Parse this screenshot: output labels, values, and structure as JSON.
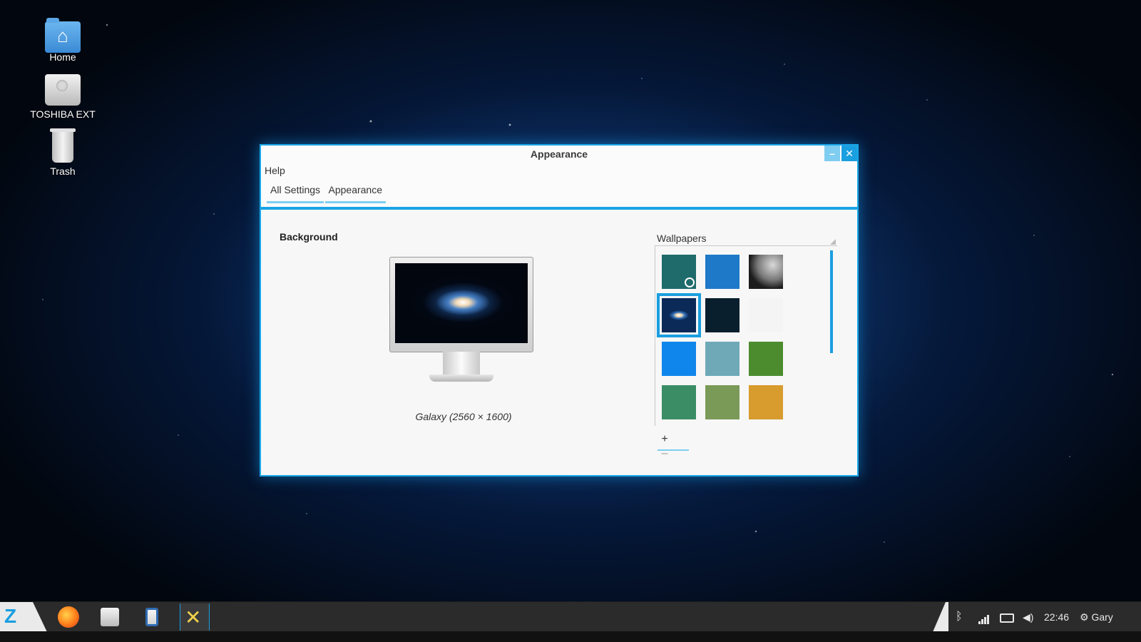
{
  "desktop": {
    "icons": [
      {
        "label": "Home",
        "icon": "folder-home-icon"
      },
      {
        "label": "TOSHIBA EXT",
        "icon": "drive-icon"
      },
      {
        "label": "Trash",
        "icon": "trash-icon"
      }
    ]
  },
  "window": {
    "title": "Appearance",
    "controls": {
      "minimize": "–",
      "close": "✕"
    },
    "menu": {
      "help": "Help"
    },
    "breadcrumb": [
      "All Settings",
      "Appearance"
    ],
    "background": {
      "heading": "Background",
      "caption": "Galaxy (2560 × 1600)"
    },
    "wallpapers": {
      "title": "Wallpapers",
      "add_label": "+",
      "remove_label": "–",
      "items": [
        {
          "name": "teal-clock",
          "color": "#1f6b6b"
        },
        {
          "name": "underwater",
          "color": "#1e79c8"
        },
        {
          "name": "moon",
          "color": "#1c1c1c"
        },
        {
          "name": "galaxy",
          "color": "#0b2a57",
          "selected": true
        },
        {
          "name": "dark-stars",
          "color": "#0a1f2e"
        },
        {
          "name": "molecules",
          "color": "#f4f4f4"
        },
        {
          "name": "blue-gradient",
          "color": "#0f86ec"
        },
        {
          "name": "sea-rocks",
          "color": "#6fa9b8"
        },
        {
          "name": "grass",
          "color": "#4c8c2f"
        },
        {
          "name": "green-rope",
          "color": "#3b8d66"
        },
        {
          "name": "wetland",
          "color": "#7a9a57"
        },
        {
          "name": "golden-drops",
          "color": "#d89b2e"
        }
      ]
    }
  },
  "colors": {
    "accent": "#1a9fe0",
    "accent_light": "#7ecff3"
  },
  "taskbar": {
    "start_logo": "Z",
    "apps": [
      "firefox-icon",
      "file-manager-icon",
      "bluetooth-device-icon",
      "system-tools-icon"
    ],
    "tray": {
      "bluetooth": "ᛒ",
      "clock": "22:46",
      "user": "Gary",
      "user_icon": "⚙"
    }
  }
}
